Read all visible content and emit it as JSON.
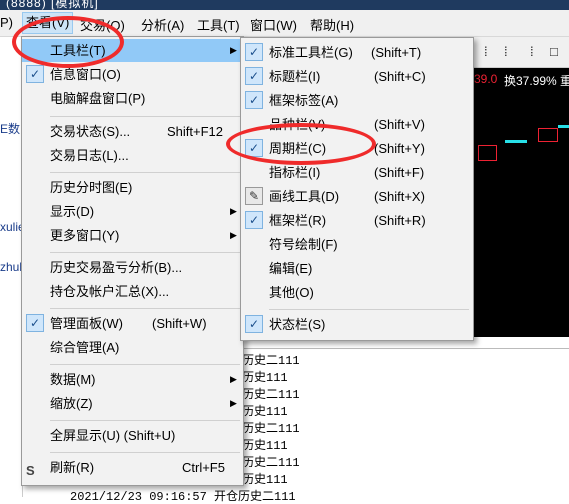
{
  "titlebar": {
    "text": "(8888) [模拟机]"
  },
  "menubar": {
    "items": [
      {
        "label": "P)"
      },
      {
        "label": "查看(V)"
      },
      {
        "label": "交易(O)"
      },
      {
        "label": "分析(A)"
      },
      {
        "label": "工具(T)"
      },
      {
        "label": "窗口(W)"
      },
      {
        "label": "帮助(H)"
      }
    ]
  },
  "left_panel": {
    "frags": [
      "E数",
      "xulie",
      "zhul"
    ]
  },
  "chart": {
    "toolbar": [
      "⁞",
      "⁞",
      "⁞",
      "□"
    ],
    "price_text": "39.0",
    "turnover_text": "换37.99%",
    "extra_text": "重"
  },
  "view_menu": {
    "items": [
      {
        "label": "工具栏(T)",
        "submenu": true
      },
      {
        "label": "信息窗口(O)",
        "checked": true
      },
      {
        "label": "电脑解盘窗口(P)"
      },
      {
        "label": "交易状态(S)...",
        "shortcut": "Shift+F12"
      },
      {
        "label": "交易日志(L)..."
      },
      {
        "label": "历史分时图(E)"
      },
      {
        "label": "显示(D)",
        "submenu": true
      },
      {
        "label": "更多窗口(Y)",
        "submenu": true
      },
      {
        "label": "历史交易盈亏分析(B)..."
      },
      {
        "label": "持仓及帐户汇总(X)..."
      },
      {
        "label": "管理面板(W)",
        "shortcut": "(Shift+W)",
        "checked": true
      },
      {
        "label": "综合管理(A)"
      },
      {
        "label": "数据(M)",
        "submenu": true
      },
      {
        "label": "缩放(Z)",
        "submenu": true
      },
      {
        "label": "全屏显示(U) (Shift+U)"
      },
      {
        "label": "刷新(R)",
        "shortcut": "Ctrl+F5",
        "icon": "refresh-icon"
      }
    ]
  },
  "toolbar_submenu": {
    "items": [
      {
        "label": "标准工具栏(G)",
        "shortcut": "(Shift+T)",
        "checked": true
      },
      {
        "label": "标题栏(I)",
        "shortcut": "(Shift+C)",
        "checked": true
      },
      {
        "label": "框架标签(A)",
        "checked": true
      },
      {
        "label": "品种栏(V)",
        "shortcut": "(Shift+V)"
      },
      {
        "label": "周期栏(C)",
        "shortcut": "(Shift+Y)",
        "checked": true
      },
      {
        "label": "指标栏(I)",
        "shortcut": "(Shift+F)"
      },
      {
        "label": "画线工具(D)",
        "shortcut": "(Shift+X)",
        "icon": "pencil-icon"
      },
      {
        "label": "框架栏(R)",
        "shortcut": "(Shift+R)",
        "checked": true
      },
      {
        "label": "符号绘制(F)"
      },
      {
        "label": "编辑(E)"
      },
      {
        "label": "其他(O)"
      },
      {
        "label": "状态栏(S)",
        "checked": true
      }
    ]
  },
  "log": {
    "rows": [
      "历史二111",
      "历史111",
      "历史二111",
      "历史111",
      "历史二111",
      "历史111",
      "历史二111",
      "历史111",
      "2021/12/23 09:16:57  开仓历史二111"
    ]
  },
  "colors": {
    "highlight": "#91c9f7",
    "annotation": "#ef2b2b",
    "chart_bg": "#000000"
  }
}
